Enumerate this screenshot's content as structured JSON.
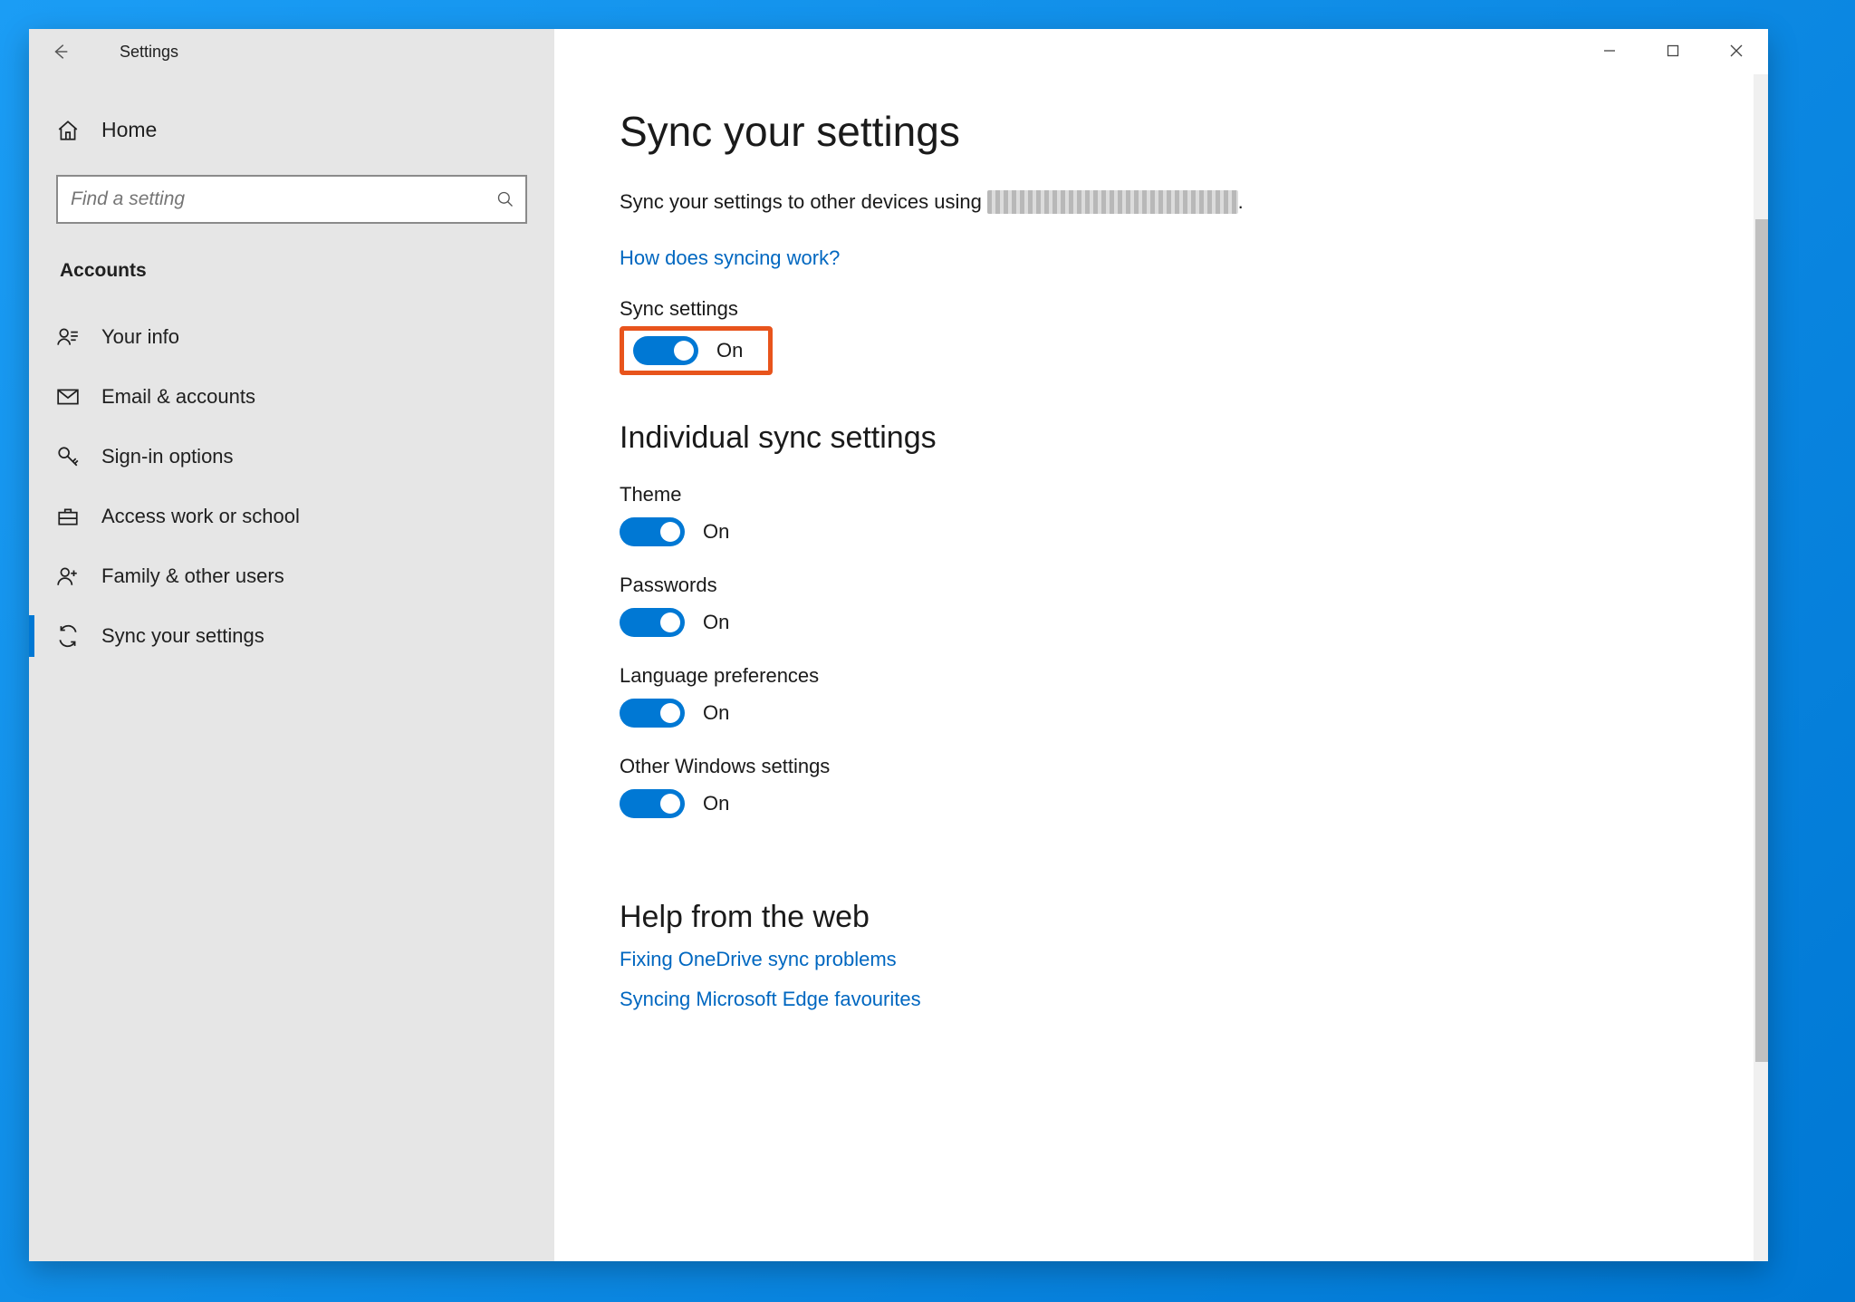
{
  "window": {
    "title": "Settings"
  },
  "sidebar": {
    "home_label": "Home",
    "search_placeholder": "Find a setting",
    "section": "Accounts",
    "items": [
      {
        "label": "Your info"
      },
      {
        "label": "Email & accounts"
      },
      {
        "label": "Sign-in options"
      },
      {
        "label": "Access work or school"
      },
      {
        "label": "Family & other users"
      },
      {
        "label": "Sync your settings"
      }
    ]
  },
  "content": {
    "title": "Sync your settings",
    "sync_desc_prefix": "Sync your settings to other devices using ",
    "sync_desc_suffix": ".",
    "how_link": "How does syncing work?",
    "sync_settings_label": "Sync settings",
    "individual_title": "Individual sync settings",
    "toggles": {
      "master": "On",
      "theme_label": "Theme",
      "theme_state": "On",
      "pw_label": "Passwords",
      "pw_state": "On",
      "lang_label": "Language preferences",
      "lang_state": "On",
      "other_label": "Other Windows settings",
      "other_state": "On"
    },
    "help_title": "Help from the web",
    "help_links": [
      "Fixing OneDrive sync problems",
      "Syncing Microsoft Edge favourites"
    ]
  }
}
